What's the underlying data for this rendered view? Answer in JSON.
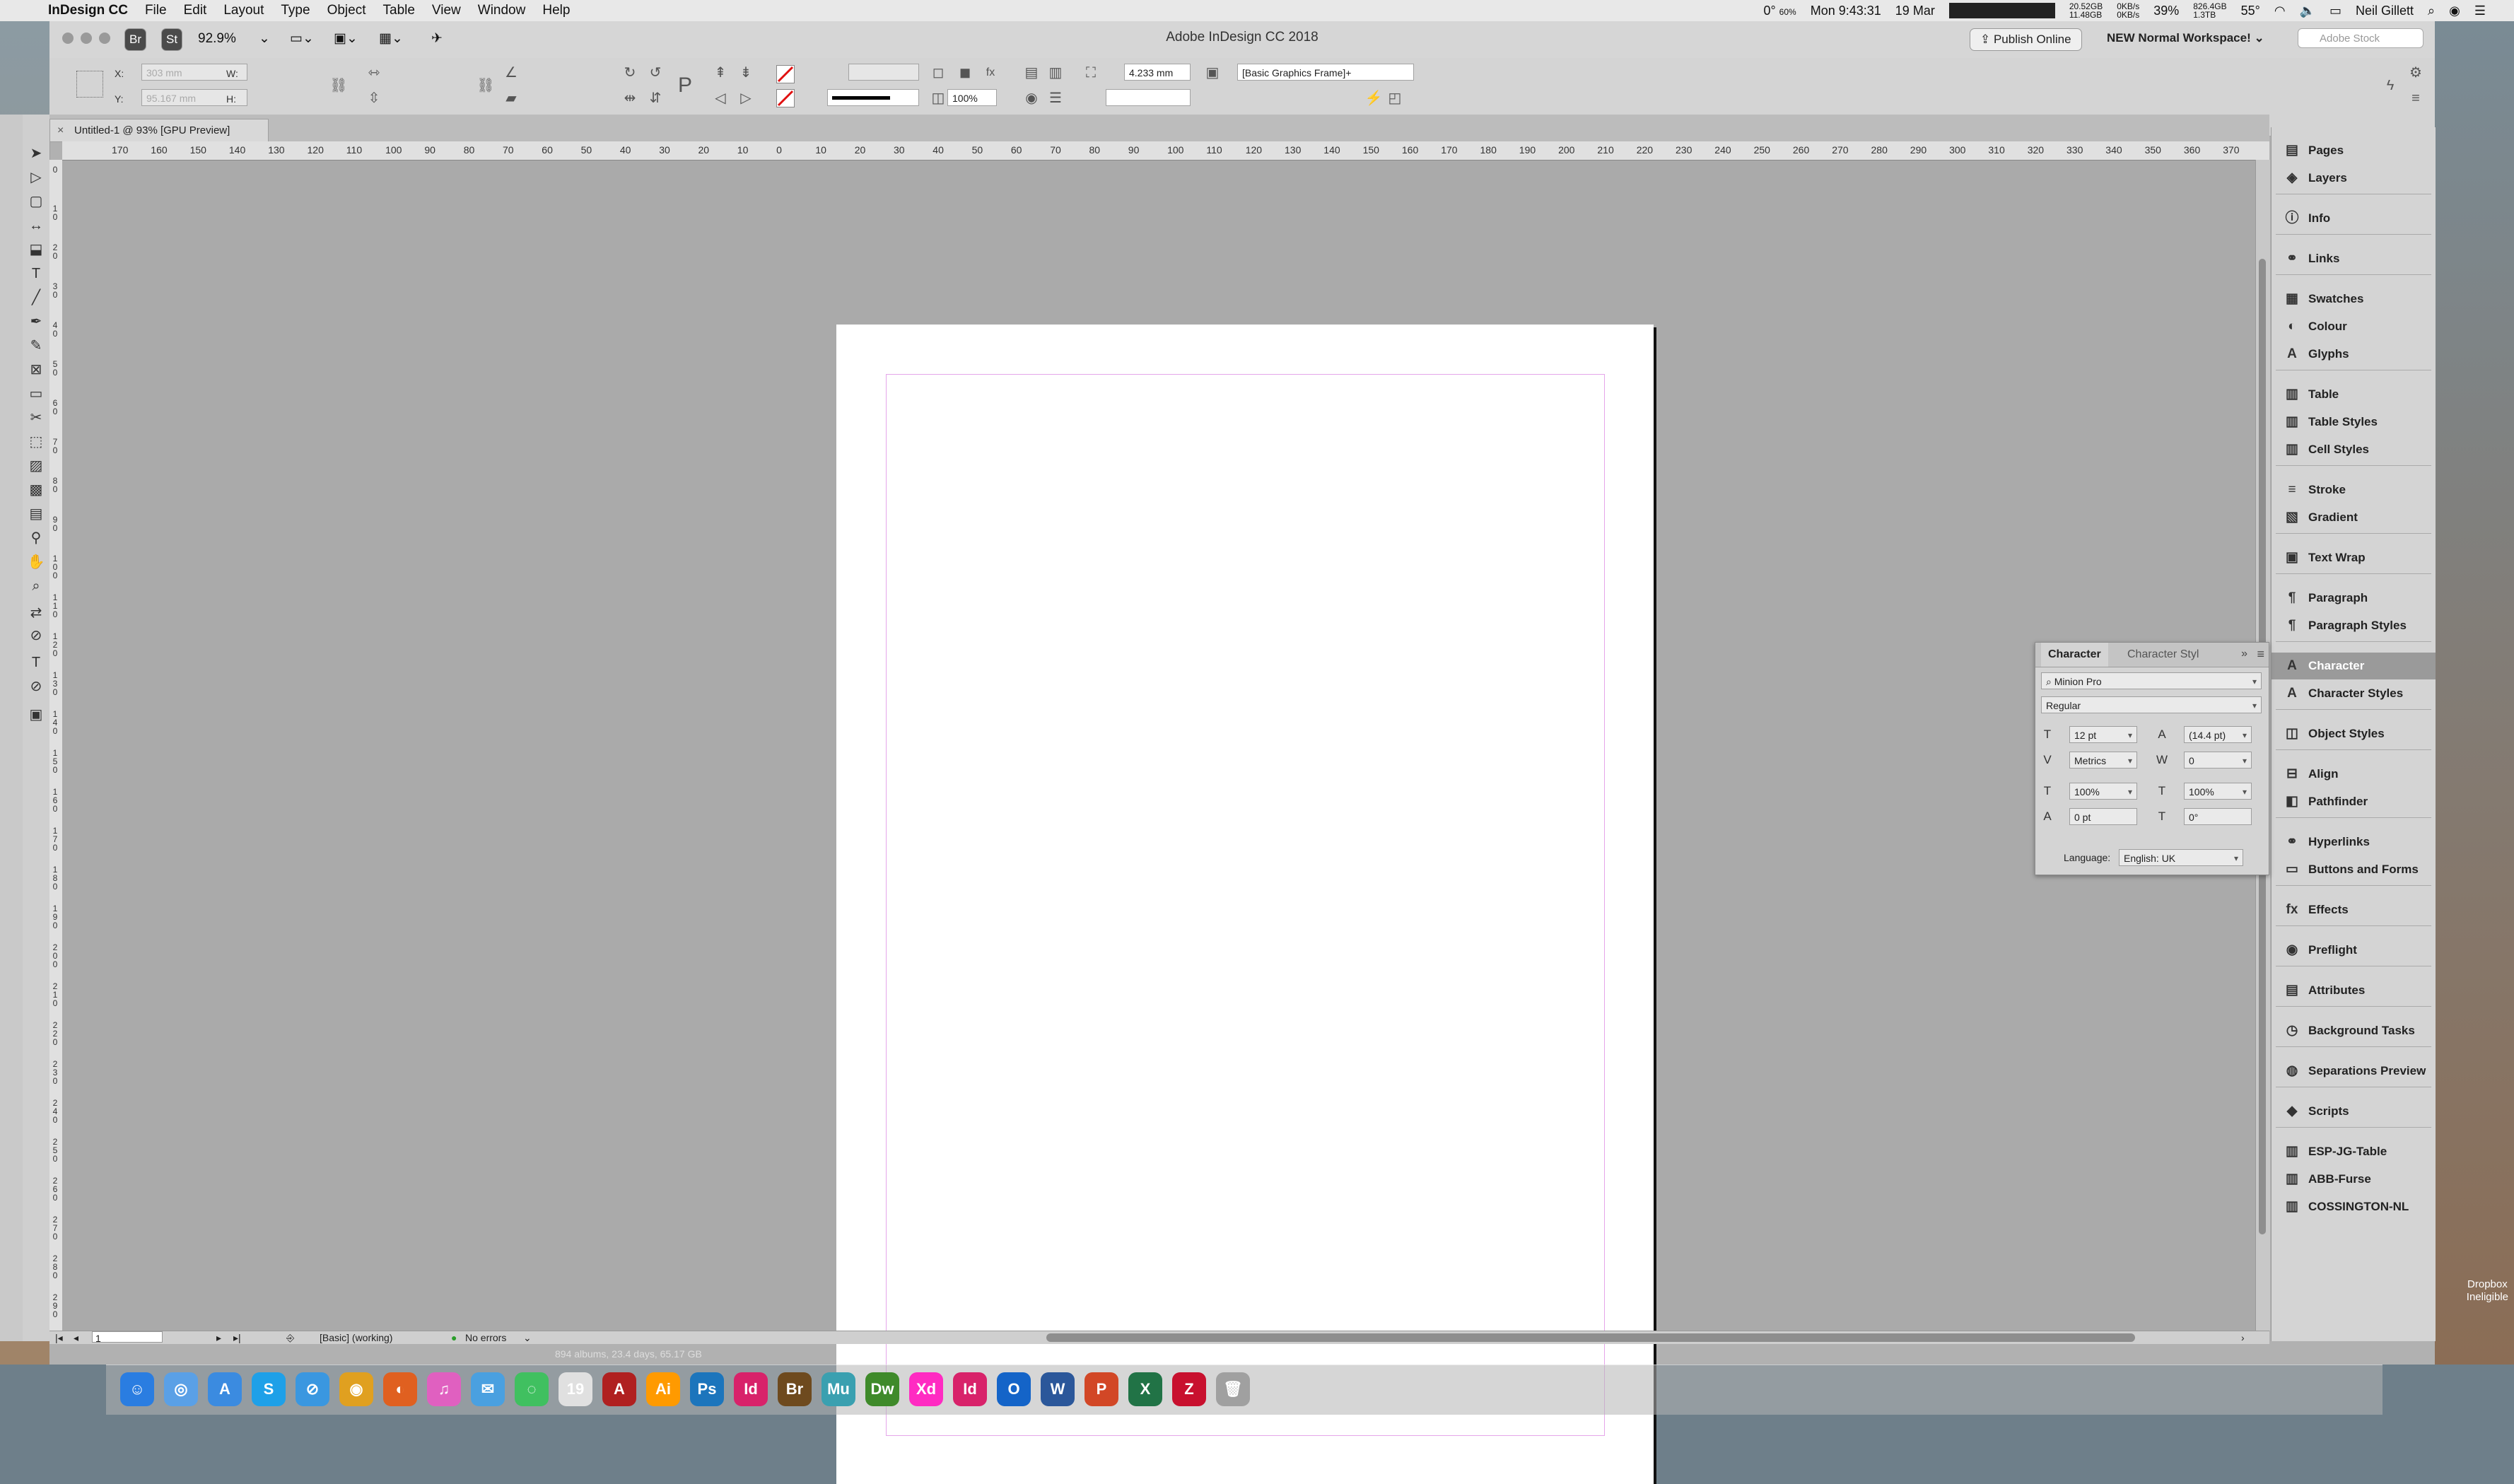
{
  "menubar": {
    "app_name": "InDesign CC",
    "menus": [
      "File",
      "Edit",
      "Layout",
      "Type",
      "Object",
      "Table",
      "View",
      "Window",
      "Help"
    ],
    "temp": "0°",
    "temp_sub": "60%",
    "clock": "Mon 9:43:31",
    "date": "Mar",
    "date_day": "19",
    "mem": "20.52GB",
    "mem_sub": "11.48GB",
    "net": "0KB/s",
    "net_sub": "0KB/s",
    "battery_pct": "39%",
    "disk": "826.4GB",
    "disk_sub": "1.3TB",
    "cpu_temp": "55°",
    "user": "Neil Gillett"
  },
  "window": {
    "title": "Adobe InDesign CC 2018",
    "zoom": "92.9%",
    "br_badge": "Br",
    "st_badge": "St",
    "publish_label": "Publish Online",
    "workspace_label": "NEW Normal Workspace!",
    "search_placeholder": "Adobe Stock"
  },
  "control": {
    "x_label": "X:",
    "x_value": "303 mm",
    "y_label": "Y:",
    "y_value": "95.167 mm",
    "w_label": "W:",
    "h_label": "H:",
    "stroke_weight": "4.233 mm",
    "opacity": "100%",
    "object_style": "[Basic Graphics Frame]+"
  },
  "doc_tab": {
    "label": "Untitled-1 @ 93% [GPU Preview]"
  },
  "ruler": {
    "h_ticks": [
      "170",
      "160",
      "150",
      "140",
      "130",
      "120",
      "110",
      "100",
      "90",
      "80",
      "70",
      "60",
      "50",
      "40",
      "30",
      "20",
      "10",
      "0",
      "10",
      "20",
      "30",
      "40",
      "50",
      "60",
      "70",
      "80",
      "90",
      "100",
      "110",
      "120",
      "130",
      "140",
      "150",
      "160",
      "170",
      "180",
      "190",
      "200",
      "210",
      "220",
      "230",
      "240",
      "250",
      "260",
      "270",
      "280",
      "290",
      "300",
      "310",
      "320",
      "330",
      "340",
      "350",
      "360",
      "370"
    ],
    "v_ticks": [
      "0",
      "1 0",
      "2 0",
      "3 0",
      "4 0",
      "5 0",
      "6 0",
      "7 0",
      "8 0",
      "9 0",
      "1 0 0",
      "1 1 0",
      "1 2 0",
      "1 3 0",
      "1 4 0",
      "1 5 0",
      "1 6 0",
      "1 7 0",
      "1 8 0",
      "1 9 0",
      "2 0 0",
      "2 1 0",
      "2 2 0",
      "2 3 0",
      "2 4 0",
      "2 5 0",
      "2 6 0",
      "2 7 0",
      "2 8 0",
      "2 9 0"
    ]
  },
  "statusbar": {
    "page": "1",
    "preflight_profile": "[Basic] (working)",
    "errors": "No errors",
    "sub": "894 albums, 23.4 days, 65.17 GB"
  },
  "panels": [
    {
      "label": "Pages",
      "icon": "pages-icon",
      "glyph": "▤"
    },
    {
      "label": "Layers",
      "icon": "layers-icon",
      "glyph": "◈"
    },
    {
      "label": "Info",
      "icon": "info-icon",
      "glyph": "ⓘ"
    },
    {
      "label": "Links",
      "icon": "links-icon",
      "glyph": "⚭"
    },
    {
      "label": "Swatches",
      "icon": "swatches-icon",
      "glyph": "▦"
    },
    {
      "label": "Colour",
      "icon": "colour-icon",
      "glyph": "◐"
    },
    {
      "label": "Glyphs",
      "icon": "glyphs-icon",
      "glyph": "A"
    },
    {
      "label": "Table",
      "icon": "table-icon",
      "glyph": "▥"
    },
    {
      "label": "Table Styles",
      "icon": "table-styles-icon",
      "glyph": "▥"
    },
    {
      "label": "Cell Styles",
      "icon": "cell-styles-icon",
      "glyph": "▥"
    },
    {
      "label": "Stroke",
      "icon": "stroke-icon",
      "glyph": "≡"
    },
    {
      "label": "Gradient",
      "icon": "gradient-icon",
      "glyph": "▧"
    },
    {
      "label": "Text Wrap",
      "icon": "text-wrap-icon",
      "glyph": "▣"
    },
    {
      "label": "Paragraph",
      "icon": "paragraph-icon",
      "glyph": "¶"
    },
    {
      "label": "Paragraph Styles",
      "icon": "paragraph-styles-icon",
      "glyph": "¶"
    },
    {
      "label": "Character",
      "icon": "character-icon",
      "glyph": "A"
    },
    {
      "label": "Character Styles",
      "icon": "character-styles-icon",
      "glyph": "A"
    },
    {
      "label": "Object Styles",
      "icon": "object-styles-icon",
      "glyph": "◫"
    },
    {
      "label": "Align",
      "icon": "align-icon",
      "glyph": "⊟"
    },
    {
      "label": "Pathfinder",
      "icon": "pathfinder-icon",
      "glyph": "◧"
    },
    {
      "label": "Hyperlinks",
      "icon": "hyperlinks-icon",
      "glyph": "⚭"
    },
    {
      "label": "Buttons and Forms",
      "icon": "buttons-forms-icon",
      "glyph": "▭"
    },
    {
      "label": "Effects",
      "icon": "effects-icon",
      "glyph": "fx"
    },
    {
      "label": "Preflight",
      "icon": "preflight-icon",
      "glyph": "◉"
    },
    {
      "label": "Attributes",
      "icon": "attributes-icon",
      "glyph": "▤"
    },
    {
      "label": "Background Tasks",
      "icon": "background-tasks-icon",
      "glyph": "◷"
    },
    {
      "label": "Separations Preview",
      "icon": "separations-icon",
      "glyph": "◍"
    },
    {
      "label": "Scripts",
      "icon": "scripts-icon",
      "glyph": "◆"
    },
    {
      "label": "ESP-JG-Table",
      "icon": "table-icon",
      "glyph": "▥"
    },
    {
      "label": "ABB-Furse",
      "icon": "table-icon",
      "glyph": "▥"
    },
    {
      "label": "COSSINGTON-NL",
      "icon": "table-icon",
      "glyph": "▥"
    }
  ],
  "character_panel": {
    "tab_active": "Character",
    "tab_inactive": "Character Styl",
    "font_family": "Minion Pro",
    "font_style": "Regular",
    "size": "12 pt",
    "leading": "(14.4 pt)",
    "kerning": "Metrics",
    "tracking": "0",
    "vscale": "100%",
    "hscale": "100%",
    "baseline": "0 pt",
    "skew": "0°",
    "language_label": "Language:",
    "language": "English: UK"
  },
  "desktop": {
    "dropbox": "Dropbox",
    "dropbox_sub": "Ineligible"
  },
  "dock": [
    {
      "name": "finder",
      "glyph": "☺",
      "color": "#2a7de1"
    },
    {
      "name": "launchpad",
      "glyph": "◎",
      "color": "#5aa0e6"
    },
    {
      "name": "app-store",
      "glyph": "A",
      "color": "#3b8be0"
    },
    {
      "name": "skype",
      "glyph": "S",
      "color": "#1ea0e8"
    },
    {
      "name": "safari",
      "glyph": "⊘",
      "color": "#3a97e0"
    },
    {
      "name": "chrome",
      "glyph": "◉",
      "color": "#e0a020"
    },
    {
      "name": "firefox",
      "glyph": "◐",
      "color": "#e06020"
    },
    {
      "name": "itunes",
      "glyph": "♫",
      "color": "#e060c0"
    },
    {
      "name": "mail",
      "glyph": "✉",
      "color": "#4aa0e0"
    },
    {
      "name": "messages",
      "glyph": "◌",
      "color": "#40c060"
    },
    {
      "name": "calendar",
      "glyph": "19",
      "color": "#e0e0e0"
    },
    {
      "name": "acrobat",
      "glyph": "A",
      "color": "#b02020"
    },
    {
      "name": "illustrator",
      "glyph": "Ai",
      "color": "#ff9a00"
    },
    {
      "name": "photoshop",
      "glyph": "Ps",
      "color": "#1c75bc"
    },
    {
      "name": "indesign",
      "glyph": "Id",
      "color": "#d8226a"
    },
    {
      "name": "bridge",
      "glyph": "Br",
      "color": "#6e4a1e"
    },
    {
      "name": "muse",
      "glyph": "Mu",
      "color": "#3aa0b0"
    },
    {
      "name": "dreamweaver",
      "glyph": "Dw",
      "color": "#3f8a2a"
    },
    {
      "name": "xd",
      "glyph": "Xd",
      "color": "#ff2bc2"
    },
    {
      "name": "indesign-2",
      "glyph": "Id",
      "color": "#d8226a"
    },
    {
      "name": "outlook",
      "glyph": "O",
      "color": "#1464c8"
    },
    {
      "name": "word",
      "glyph": "W",
      "color": "#2b579a"
    },
    {
      "name": "powerpoint",
      "glyph": "P",
      "color": "#d24726"
    },
    {
      "name": "excel",
      "glyph": "X",
      "color": "#217346"
    },
    {
      "name": "filezilla",
      "glyph": "Z",
      "color": "#c8102e"
    },
    {
      "name": "trash",
      "glyph": "🗑",
      "color": "#a0a0a0"
    }
  ]
}
